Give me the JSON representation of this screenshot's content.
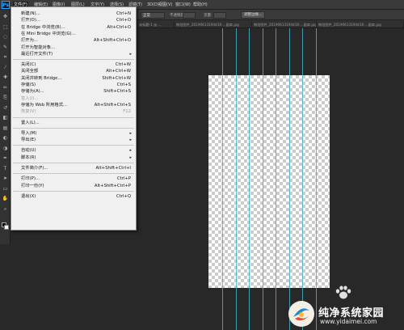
{
  "app": {
    "logo": "Ps"
  },
  "menubar": {
    "items": [
      {
        "label": "文件(F)",
        "active": true
      },
      {
        "label": "编辑(E)"
      },
      {
        "label": "图像(I)"
      },
      {
        "label": "图层(L)"
      },
      {
        "label": "文字(Y)"
      },
      {
        "label": "选择(S)"
      },
      {
        "label": "滤镜(T)"
      },
      {
        "label": "3D(D)"
      },
      {
        "label": "视图(V)"
      },
      {
        "label": "窗口(W)"
      },
      {
        "label": "帮助(H)"
      }
    ]
  },
  "options_bar": {
    "mode_value": "正常",
    "opacity_label": "不透明度:",
    "flow_label": "流量:",
    "refine_button": "调整边缘..."
  },
  "tabs": [
    {
      "label": "未标题-1 @ ..."
    },
    {
      "label": "微信图片_20190613194416-...副本.jpg"
    },
    {
      "label": "微信图片_20190613194416-...副本.jpg"
    },
    {
      "label": "微信图片_20190613194416-...副本.jpg"
    }
  ],
  "file_menu": {
    "items": [
      {
        "label": "新建(N)...",
        "shortcut": "Ctrl+N"
      },
      {
        "label": "打开(O)...",
        "shortcut": "Ctrl+O"
      },
      {
        "label": "在 Bridge 中浏览(B)...",
        "shortcut": "Alt+Ctrl+O"
      },
      {
        "label": "在 Mini Bridge 中浏览(G)...",
        "shortcut": ""
      },
      {
        "label": "打开为...",
        "shortcut": "Alt+Shift+Ctrl+O"
      },
      {
        "label": "打开为智能对象...",
        "shortcut": ""
      },
      {
        "label": "最近打开文件(T)",
        "shortcut": "",
        "submenu": true
      },
      {
        "sep": true
      },
      {
        "label": "关闭(C)",
        "shortcut": "Ctrl+W"
      },
      {
        "label": "关闭全部",
        "shortcut": "Alt+Ctrl+W"
      },
      {
        "label": "关闭并转到 Bridge...",
        "shortcut": "Shift+Ctrl+W"
      },
      {
        "label": "存储(S)",
        "shortcut": "Ctrl+S"
      },
      {
        "label": "存储为(A)...",
        "shortcut": "Shift+Ctrl+S"
      },
      {
        "label": "签入(I)...",
        "shortcut": "",
        "disabled": true
      },
      {
        "label": "存储为 Web 所用格式...",
        "shortcut": "Alt+Shift+Ctrl+S"
      },
      {
        "label": "恢复(V)",
        "shortcut": "F12",
        "disabled": true
      },
      {
        "sep": true
      },
      {
        "label": "置入(L)...",
        "shortcut": ""
      },
      {
        "sep": true
      },
      {
        "label": "导入(M)",
        "shortcut": "",
        "submenu": true
      },
      {
        "label": "导出(E)",
        "shortcut": "",
        "submenu": true
      },
      {
        "sep": true
      },
      {
        "label": "自动(U)",
        "shortcut": "",
        "submenu": true
      },
      {
        "label": "脚本(R)",
        "shortcut": "",
        "submenu": true
      },
      {
        "sep": true
      },
      {
        "label": "文件简介(F)...",
        "shortcut": "Alt+Shift+Ctrl+I"
      },
      {
        "sep": true
      },
      {
        "label": "打印(P)...",
        "shortcut": "Ctrl+P"
      },
      {
        "label": "打印一份(Y)",
        "shortcut": "Alt+Shift+Ctrl+P"
      },
      {
        "sep": true
      },
      {
        "label": "退出(X)",
        "shortcut": "Ctrl+Q"
      }
    ]
  },
  "toolbar": {
    "tools": [
      "move-icon",
      "marquee-icon",
      "lasso-icon",
      "quick-select-icon",
      "crop-icon",
      "eyedropper-icon",
      "healing-brush-icon",
      "brush-icon",
      "clone-stamp-icon",
      "history-brush-icon",
      "eraser-icon",
      "gradient-icon",
      "blur-icon",
      "dodge-icon",
      "pen-icon",
      "type-icon",
      "path-select-icon",
      "shape-icon",
      "hand-icon",
      "zoom-icon"
    ]
  },
  "watermark": {
    "title": "纯净系统家园",
    "url": "www.yidaimei.com"
  }
}
